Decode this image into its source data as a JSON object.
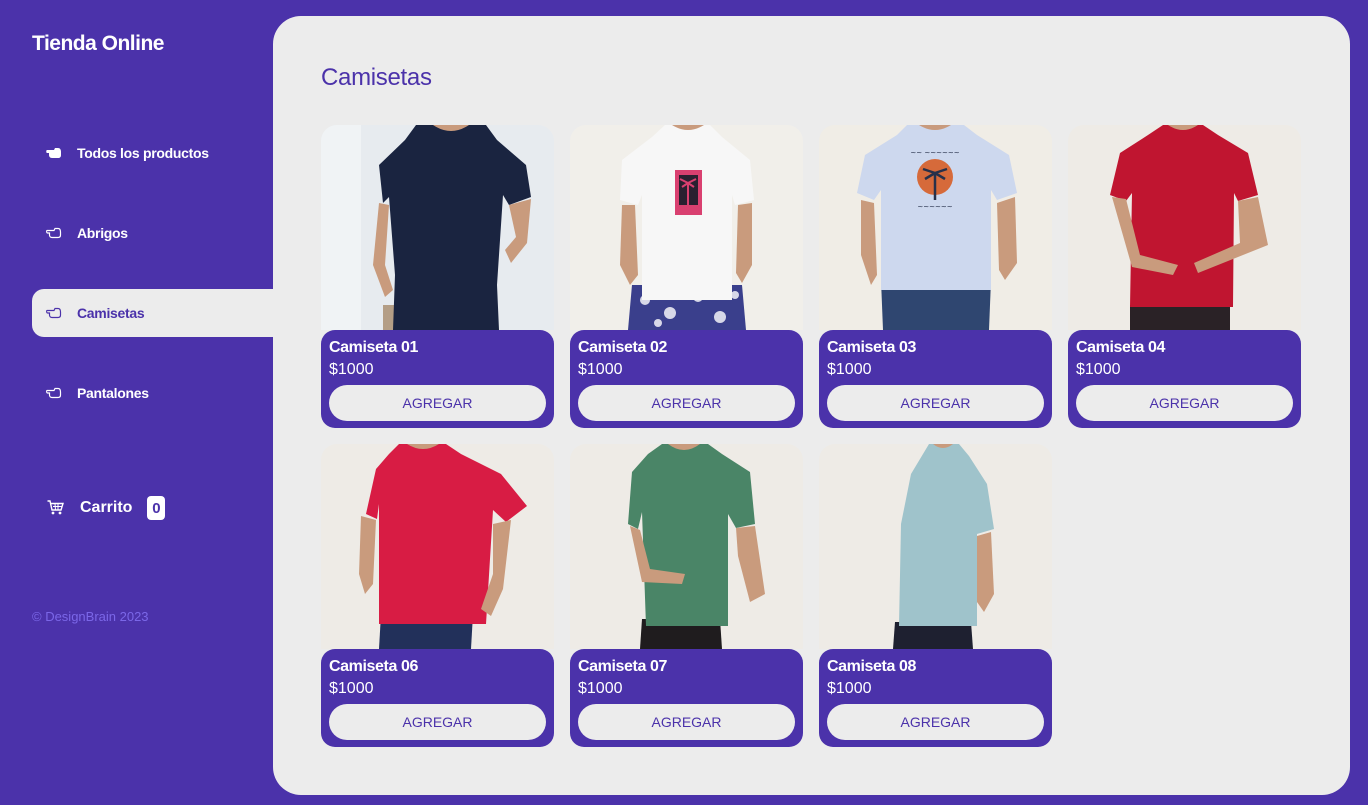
{
  "brand": "Tienda Online",
  "menu": [
    {
      "label": "Todos los productos",
      "icon": "hand-pointing-filled-icon",
      "active": false
    },
    {
      "label": "Abrigos",
      "icon": "hand-pointing-icon",
      "active": false
    },
    {
      "label": "Camisetas",
      "icon": "hand-pointing-icon",
      "active": true
    },
    {
      "label": "Pantalones",
      "icon": "hand-pointing-icon",
      "active": false
    }
  ],
  "cart": {
    "label": "Carrito",
    "count": "0",
    "icon": "cart-icon"
  },
  "footer": "© DesignBrain 2023",
  "page_title": "Camisetas",
  "colors": {
    "accent": "#4b32aa",
    "panel": "#ececec",
    "footer_text": "#7b67e8"
  },
  "products": [
    {
      "name": "Camiseta 01",
      "price": "$1000",
      "button": "AGREGAR",
      "shirt_color": "#1a2440"
    },
    {
      "name": "Camiseta 02",
      "price": "$1000",
      "button": "AGREGAR",
      "shirt_color": "#f7f7f7"
    },
    {
      "name": "Camiseta 03",
      "price": "$1000",
      "button": "AGREGAR",
      "shirt_color": "#cdd8ee"
    },
    {
      "name": "Camiseta 04",
      "price": "$1000",
      "button": "AGREGAR",
      "shirt_color": "#c01530"
    },
    {
      "name": "Camiseta 06",
      "price": "$1000",
      "button": "AGREGAR",
      "shirt_color": "#d81c44"
    },
    {
      "name": "Camiseta 07",
      "price": "$1000",
      "button": "AGREGAR",
      "shirt_color": "#4a8567"
    },
    {
      "name": "Camiseta 08",
      "price": "$1000",
      "button": "AGREGAR",
      "shirt_color": "#9fc3cb"
    }
  ]
}
